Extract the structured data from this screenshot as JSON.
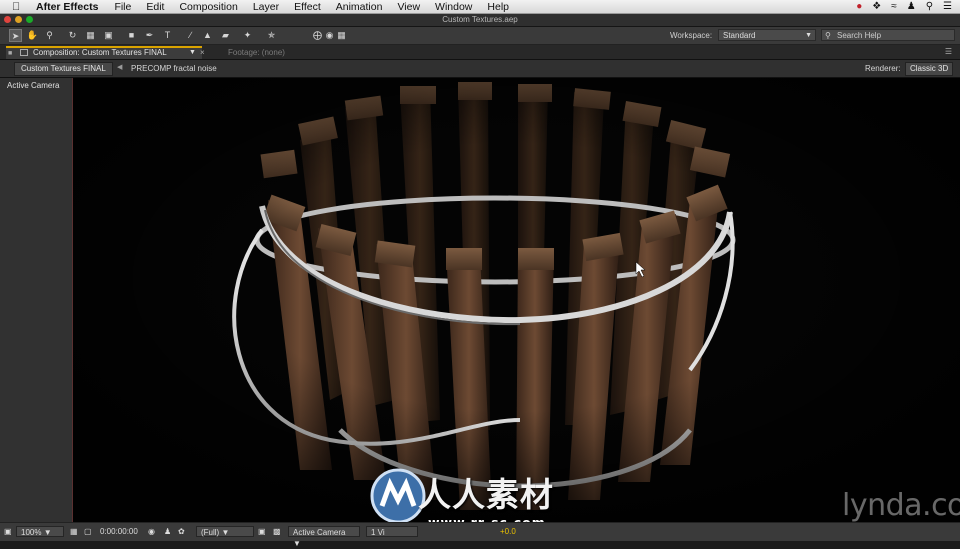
{
  "menubar": {
    "app_name": "After Effects",
    "items": [
      "File",
      "Edit",
      "Composition",
      "Layer",
      "Effect",
      "Animation",
      "View",
      "Window",
      "Help"
    ]
  },
  "window": {
    "title": "Custom Textures.aep"
  },
  "workspace": {
    "label": "Workspace:",
    "value": "Standard"
  },
  "search": {
    "placeholder": "Search Help"
  },
  "tabs": {
    "composition": "Composition: Custom Textures FINAL",
    "footage": "Footage: (none)"
  },
  "comp_nav": {
    "current": "Custom Textures FINAL",
    "precomp": "PRECOMP fractal noise"
  },
  "renderer": {
    "label": "Renderer:",
    "value": "Classic 3D"
  },
  "viewer": {
    "view_label": "Active Camera"
  },
  "bottom": {
    "zoom": "100%",
    "timecode": "0:00:00:00",
    "resolution": "(Full)",
    "view": "Active Camera",
    "views": "1 Vi",
    "exposure": "+0.0"
  },
  "watermark": {
    "text": "人人素材",
    "url": "www.rr-sc.com"
  },
  "brand": {
    "text": "lynda.com"
  },
  "colors": {
    "accent_tab": "#d9a300",
    "viewer_bg": "#040404",
    "panel_bg": "#3a3a3a"
  }
}
